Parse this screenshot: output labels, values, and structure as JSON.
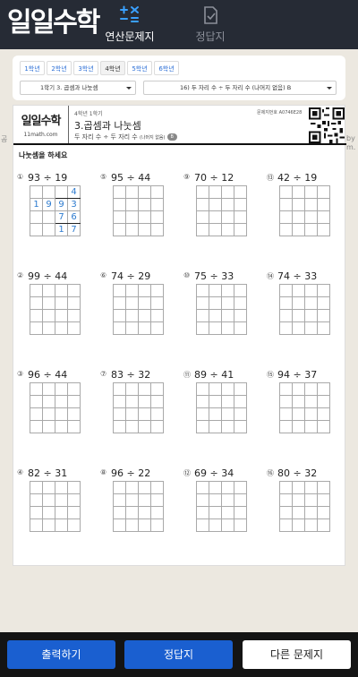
{
  "header": {
    "logo": "일일수학",
    "tabs": [
      {
        "label": "연산문제지",
        "icon": "math-operators-icon",
        "active": true
      },
      {
        "label": "정답지",
        "icon": "answer-sheet-icon",
        "active": false
      }
    ]
  },
  "selector": {
    "grades": [
      "1학년",
      "2학년",
      "3학년",
      "4학년",
      "5학년",
      "6학년"
    ],
    "active_grade": "4학년",
    "unit_select": "1학기 3. 곱셈과 나눗셈",
    "type_select": "16) 두 자리 수 ÷ 두 자리 수 (나머지 없음) B"
  },
  "sheet": {
    "logo": "일일수학",
    "site": "11math.com",
    "meta": "4학년 1학기",
    "title": "3.곱셈과 나눗셈",
    "subtitle": "두 자리 수 ÷ 두 자리 수",
    "subtitle_small": "(나머지 없음)",
    "badge": "B",
    "code": "문제지번호 A0746E28",
    "instruction": "나눗셈을 하세요",
    "side_left": "공",
    "side_right": "by\nm.",
    "problems": [
      {
        "num": "①",
        "expr": "93 ÷ 19"
      },
      {
        "num": "⑤",
        "expr": "95 ÷ 44"
      },
      {
        "num": "⑨",
        "expr": "70 ÷ 12"
      },
      {
        "num": "⑬",
        "expr": "42 ÷ 19"
      },
      {
        "num": "②",
        "expr": "99 ÷ 44"
      },
      {
        "num": "⑥",
        "expr": "74 ÷ 29"
      },
      {
        "num": "⑩",
        "expr": "75 ÷ 33"
      },
      {
        "num": "⑭",
        "expr": "74 ÷ 33"
      },
      {
        "num": "③",
        "expr": "96 ÷ 44"
      },
      {
        "num": "⑦",
        "expr": "83 ÷ 32"
      },
      {
        "num": "⑪",
        "expr": "89 ÷ 41"
      },
      {
        "num": "⑮",
        "expr": "94 ÷ 37"
      },
      {
        "num": "④",
        "expr": "82 ÷ 31"
      },
      {
        "num": "⑧",
        "expr": "96 ÷ 22"
      },
      {
        "num": "⑫",
        "expr": "69 ÷ 34"
      },
      {
        "num": "⑯",
        "expr": "80 ÷ 32"
      }
    ],
    "example_work": [
      [
        "",
        "",
        "",
        "4"
      ],
      [
        "1",
        "9",
        "9",
        "3"
      ],
      [
        "",
        "",
        "7",
        "6"
      ],
      [
        "",
        "",
        "1",
        "7"
      ]
    ]
  },
  "bottom": {
    "print": "출력하기",
    "answer": "정답지",
    "other": "다른 문제지"
  },
  "colors": {
    "header_bg": "#262b35",
    "accent_blue": "#1a5fd0",
    "work_digits": "#2d7bcf"
  }
}
